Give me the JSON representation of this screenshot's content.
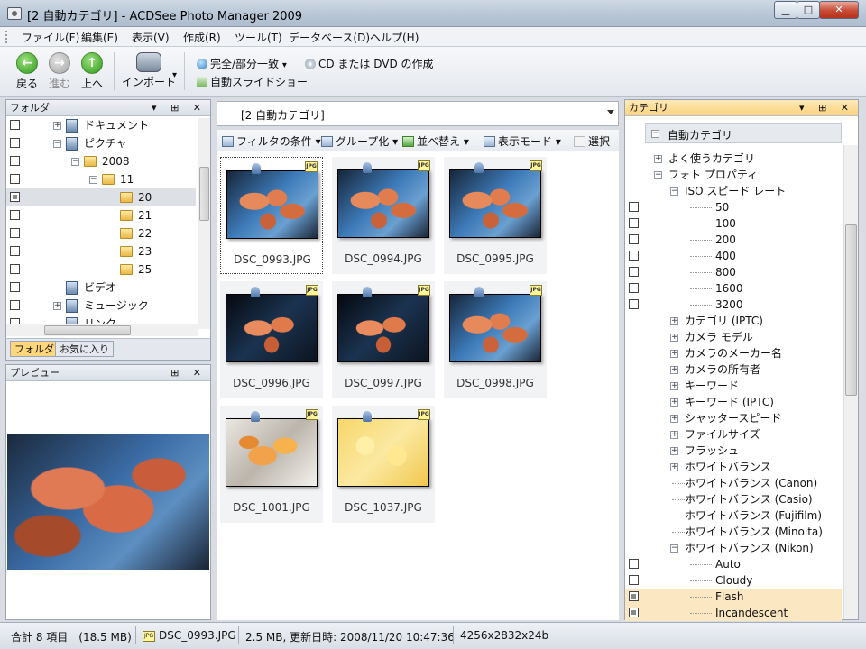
{
  "window": {
    "title": "[2 自動カテゴリ] - ACDSee Photo Manager 2009",
    "min_glyph": "▁",
    "max_glyph": "□",
    "close_glyph": "✕"
  },
  "menu": [
    "ファイル(F)",
    "編集(E)",
    "表示(V)",
    "作成(R)",
    "ツール(T)",
    "データベース(D)",
    "ヘルプ(H)"
  ],
  "toolbar": {
    "back": "戻る",
    "forward": "進む",
    "up": "上へ",
    "import": "インポート",
    "match": "完全/部分一致",
    "cd_dvd": "CD または DVD の作成",
    "slideshow": "自動スライドショー",
    "dropdown_glyph": "▾"
  },
  "folders_panel": {
    "title": "フォルダ",
    "items": [
      {
        "label": "ドキュメント",
        "checked": false
      },
      {
        "label": "ピクチャ",
        "checked": false
      },
      {
        "label": "2008",
        "checked": false
      },
      {
        "label": "11",
        "checked": false
      },
      {
        "label": "20",
        "checked": true
      },
      {
        "label": "21",
        "checked": false
      },
      {
        "label": "22",
        "checked": false
      },
      {
        "label": "23",
        "checked": false
      },
      {
        "label": "25",
        "checked": false
      },
      {
        "label": "ビデオ",
        "checked": false
      },
      {
        "label": "ミュージック",
        "checked": false
      },
      {
        "label": "リンク",
        "checked": false
      }
    ],
    "tabs": [
      "フォルダ",
      "お気に入り"
    ]
  },
  "preview_panel": {
    "title": "プレビュー"
  },
  "address": {
    "path": "[2 自動カテゴリ]"
  },
  "view_toolbar": {
    "filter": "フィルタの条件",
    "group": "グループ化",
    "sort": "並べ替え",
    "view_mode": "表示モード",
    "select": "選択"
  },
  "thumbnails": [
    {
      "name": "DSC_0993.JPG",
      "style": "leaf",
      "selected": true
    },
    {
      "name": "DSC_0994.JPG",
      "style": "leaf",
      "selected": false
    },
    {
      "name": "DSC_0995.JPG",
      "style": "leaf",
      "selected": false
    },
    {
      "name": "DSC_0996.JPG",
      "style": "leaf",
      "selected": false
    },
    {
      "name": "DSC_0997.JPG",
      "style": "leaf",
      "selected": false
    },
    {
      "name": "DSC_0998.JPG",
      "style": "leaf",
      "selected": false
    },
    {
      "name": "DSC_1001.JPG",
      "style": "leaf2",
      "selected": false
    },
    {
      "name": "DSC_1037.JPG",
      "style": "yellow",
      "selected": false
    }
  ],
  "category_panel": {
    "title": "カテゴリ",
    "root": "自動カテゴリ",
    "items": [
      {
        "label": "よく使うカテゴリ",
        "level": 1,
        "expander": "+",
        "check": false
      },
      {
        "label": "フォト プロパティ",
        "level": 1,
        "expander": "−",
        "check": false
      },
      {
        "label": "ISO スピード レート",
        "level": 2,
        "expander": "−",
        "check": false
      },
      {
        "label": "50",
        "level": 3,
        "expander": "",
        "check": "empty"
      },
      {
        "label": "100",
        "level": 3,
        "expander": "",
        "check": "empty"
      },
      {
        "label": "200",
        "level": 3,
        "expander": "",
        "check": "empty"
      },
      {
        "label": "400",
        "level": 3,
        "expander": "",
        "check": "empty"
      },
      {
        "label": "800",
        "level": 3,
        "expander": "",
        "check": "empty"
      },
      {
        "label": "1600",
        "level": 3,
        "expander": "",
        "check": "empty"
      },
      {
        "label": "3200",
        "level": 3,
        "expander": "",
        "check": "empty"
      },
      {
        "label": "カテゴリ (IPTC)",
        "level": 2,
        "expander": "+",
        "check": false
      },
      {
        "label": "カメラ モデル",
        "level": 2,
        "expander": "+",
        "check": false
      },
      {
        "label": "カメラのメーカー名",
        "level": 2,
        "expander": "+",
        "check": false
      },
      {
        "label": "カメラの所有者",
        "level": 2,
        "expander": "+",
        "check": false
      },
      {
        "label": "キーワード",
        "level": 2,
        "expander": "+",
        "check": false
      },
      {
        "label": "キーワード (IPTC)",
        "level": 2,
        "expander": "+",
        "check": false
      },
      {
        "label": "シャッタースピード",
        "level": 2,
        "expander": "+",
        "check": false
      },
      {
        "label": "ファイルサイズ",
        "level": 2,
        "expander": "+",
        "check": false
      },
      {
        "label": "フラッシュ",
        "level": 2,
        "expander": "+",
        "check": false
      },
      {
        "label": "ホワイトバランス",
        "level": 2,
        "expander": "+",
        "check": false
      },
      {
        "label": "ホワイトバランス (Canon)",
        "level": 2,
        "expander": "",
        "check": false
      },
      {
        "label": "ホワイトバランス (Casio)",
        "level": 2,
        "expander": "",
        "check": false
      },
      {
        "label": "ホワイトバランス (Fujifilm)",
        "level": 2,
        "expander": "",
        "check": false
      },
      {
        "label": "ホワイトバランス (Minolta)",
        "level": 2,
        "expander": "",
        "check": false
      },
      {
        "label": "ホワイトバランス (Nikon)",
        "level": 2,
        "expander": "−",
        "check": false
      },
      {
        "label": "Auto",
        "level": 3,
        "expander": "",
        "check": "empty"
      },
      {
        "label": "Cloudy",
        "level": 3,
        "expander": "",
        "check": "empty"
      },
      {
        "label": "Flash",
        "level": 3,
        "expander": "",
        "check": "mixed",
        "highlight": true
      },
      {
        "label": "Incandescent",
        "level": 3,
        "expander": "",
        "check": "mixed",
        "highlight": true
      }
    ]
  },
  "status": {
    "total": "合計 8 項目　(18.5 MB)",
    "file": "DSC_0993.JPG",
    "info": "2.5 MB, 更新日時: 2008/11/20 10:47:36",
    "dims": "4256x2832x24b"
  },
  "colors": {
    "accent_active_header": "#fbd27d",
    "selection_highlight": "#fbe7c1"
  }
}
